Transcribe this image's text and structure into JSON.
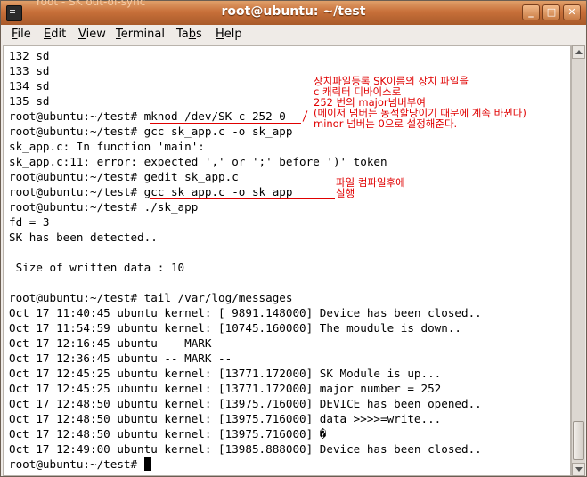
{
  "window": {
    "title": "root@ubuntu: ~/test",
    "ghost_title": "root - SK out-of-sync",
    "controls": {
      "minimize": "_",
      "maximize": "□",
      "close": "✕"
    }
  },
  "menu": [
    {
      "label": "File",
      "mnemonic": "F",
      "rest": "ile"
    },
    {
      "label": "Edit",
      "mnemonic": "E",
      "rest": "dit"
    },
    {
      "label": "View",
      "mnemonic": "V",
      "rest": "iew"
    },
    {
      "label": "Terminal",
      "mnemonic": "T",
      "rest": "erminal"
    },
    {
      "label": "Tabs",
      "mnemonic": "b",
      "pre": "Ta",
      "rest": "s"
    },
    {
      "label": "Help",
      "mnemonic": "H",
      "rest": "elp"
    }
  ],
  "terminal_lines": [
    "132 sd",
    "133 sd",
    "134 sd",
    "135 sd",
    "root@ubuntu:~/test# mknod /dev/SK c 252 0",
    "root@ubuntu:~/test# gcc sk_app.c -o sk_app",
    "sk_app.c: In function 'main':",
    "sk_app.c:11: error: expected ',' or ';' before ')' token",
    "root@ubuntu:~/test# gedit sk_app.c",
    "root@ubuntu:~/test# gcc sk_app.c -o sk_app",
    "root@ubuntu:~/test# ./sk_app",
    "fd = 3",
    "SK has been detected..",
    "",
    " Size of written data : 10",
    "",
    "root@ubuntu:~/test# tail /var/log/messages",
    "Oct 17 11:40:45 ubuntu kernel: [ 9891.148000] Device has been closed..",
    "Oct 17 11:54:59 ubuntu kernel: [10745.160000] The moudule is down..",
    "Oct 17 12:16:45 ubuntu -- MARK --",
    "Oct 17 12:36:45 ubuntu -- MARK --",
    "Oct 17 12:45:25 ubuntu kernel: [13771.172000] SK Module is up...",
    "Oct 17 12:45:25 ubuntu kernel: [13771.172000] major number = 252",
    "Oct 17 12:48:50 ubuntu kernel: [13975.716000] DEVICE has been opened..",
    "Oct 17 12:48:50 ubuntu kernel: [13975.716000] data >>>>=write...",
    "Oct 17 12:48:50 ubuntu kernel: [13975.716000] �",
    "Oct 17 12:49:00 ubuntu kernel: [13985.888000] Device has been closed..",
    "root@ubuntu:~/test# "
  ],
  "annotations": {
    "mknod_note": [
      "장치파일등록 SK이름의 장치 파일을",
      "c 캐릭터 디바이스로",
      "252 번의 major넘버부여",
      "(메이저 넘버는 동적할당이기 때문에 계속 바뀐다)",
      "minor 넘버는 0으로 설정해준다."
    ],
    "gcc_note": [
      "파일 컴파일후에",
      "실행"
    ]
  },
  "colors": {
    "titlebar": "#c8703a",
    "annotation": "#e00000",
    "terminal_bg": "#ffffff",
    "terminal_fg": "#000000"
  }
}
